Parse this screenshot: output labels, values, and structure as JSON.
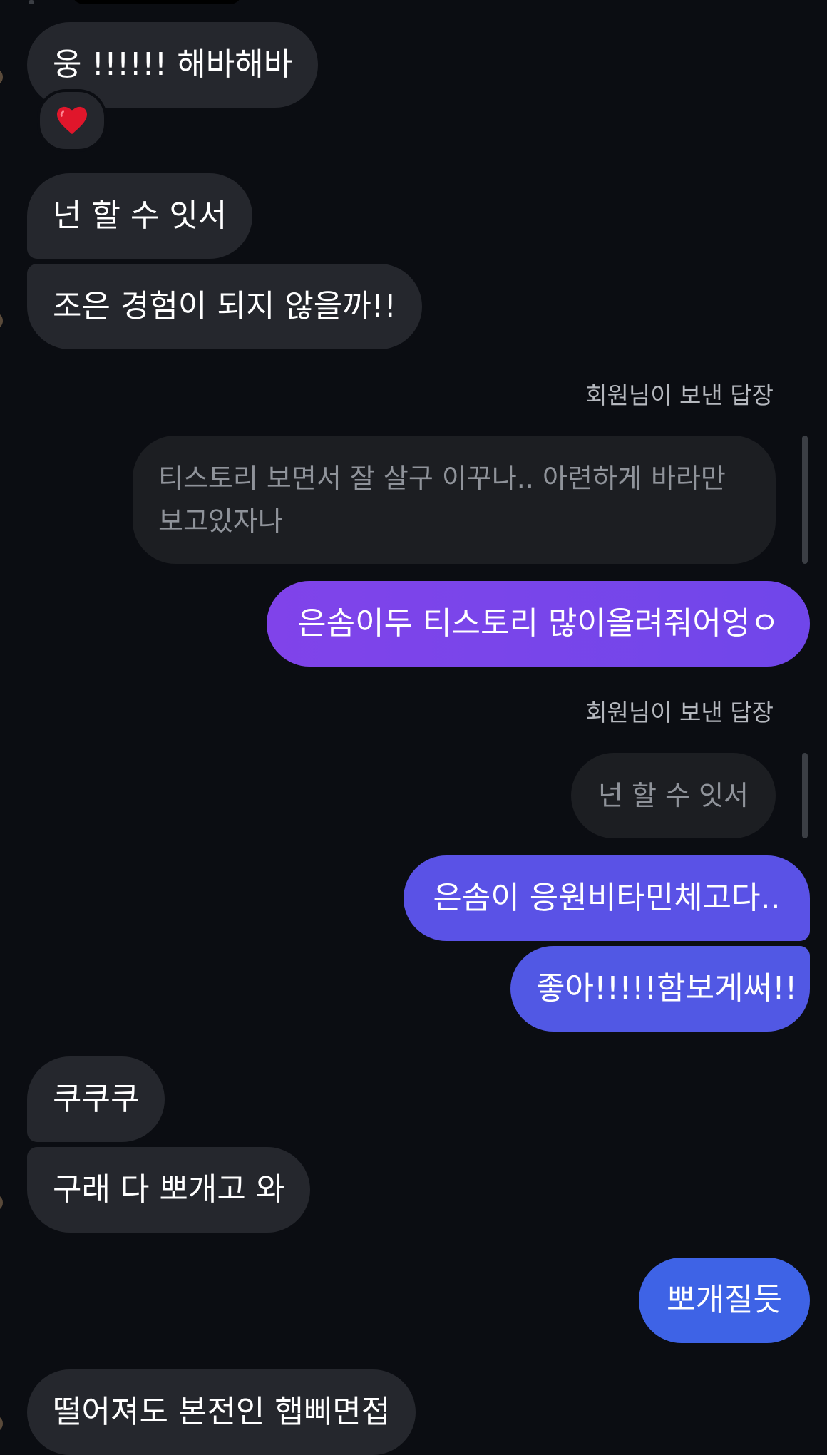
{
  "messages": {
    "m1": "웅 !!!!!! 해바해바",
    "m2": "넌 할 수 잇서",
    "m3": "조은 경험이 되지 않을까!!",
    "m4": "은솜이두 티스토리 많이올려줘어엉ㅇ",
    "m5": "은솜이 응원비타민체고다..",
    "m6": "좋아!!!!!함보게써!!",
    "m7": "쿠쿠쿠",
    "m8": "구래 다 뽀개고 와",
    "m9": "뽀개질듯",
    "m10": "떨어져도 본전인 햅삐면접"
  },
  "replies": {
    "label": "회원님이 보낸 답장",
    "quote1_line1": "티스토리 보면서 잘 살구 이꾸나.. 아련하게 바라만",
    "quote1_line2": "보고있자나",
    "quote2": "넌 할 수 잇서"
  },
  "reaction": {
    "emoji": "❤️",
    "icon": "heart-icon"
  },
  "colors": {
    "background": "#0b0d12",
    "incoming_bubble": "#25272d",
    "outgoing_gradient": [
      "#7a45ea",
      "#5256e4",
      "#3d62e6"
    ]
  }
}
